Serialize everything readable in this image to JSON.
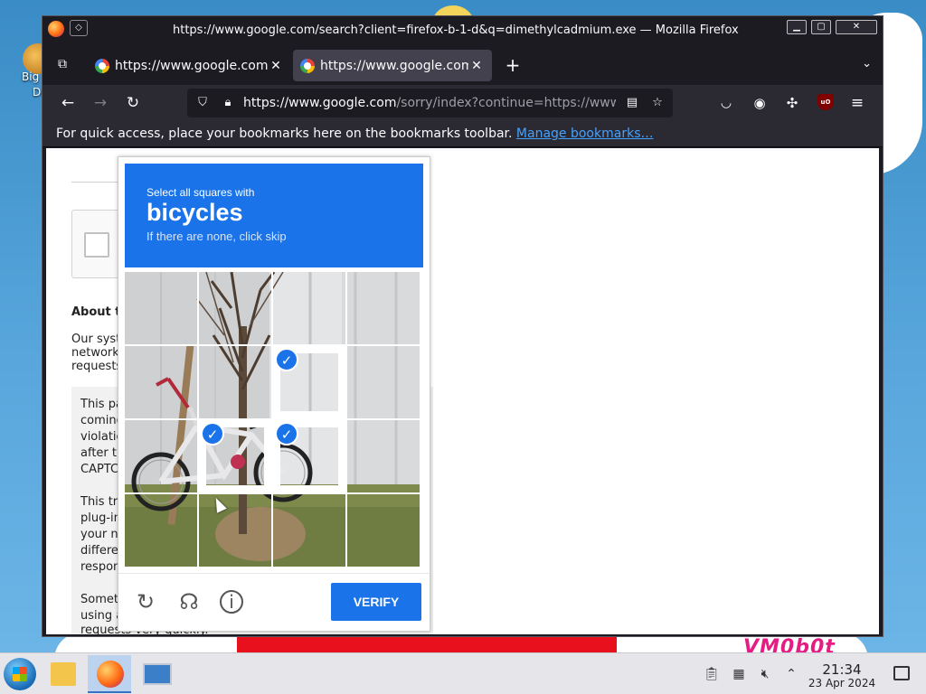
{
  "desktop": {
    "icon_label_line1": "Big",
    "icon_label_line2": "De",
    "watermark": "VM0b0t"
  },
  "window": {
    "title": "https://www.google.com/search?client=firefox-b-1-d&q=dimethylcadmium.exe — Mozilla Firefox",
    "minimize_glyph": "▁",
    "maximize_glyph": "▢",
    "close_glyph": "✕"
  },
  "tabs": [
    {
      "label": "https://www.google.com/search",
      "close": "✕",
      "active": false
    },
    {
      "label": "https://www.google.com/sorry",
      "close": "✕",
      "active": true
    }
  ],
  "tabbar": {
    "new_tab": "+",
    "list_all": "⌄"
  },
  "navbar": {
    "back": "←",
    "forward": "→",
    "reload": "↻",
    "url_host": "https://www.google.com",
    "url_path": "/sorry/index?continue=https://www.google.com/search"
  },
  "bookmarks": {
    "text": "For quick access, place your bookmarks here on the bookmarks toolbar.",
    "link": "Manage bookmarks…"
  },
  "page": {
    "about_heading": "About th",
    "intro_lines": [
      "Our syste",
      "network.",
      "requests"
    ],
    "info_block1": [
      "This pa",
      "coming",
      "violatio",
      "after th",
      "CAPTC"
    ],
    "info_block2": [
      "This tra",
      "plug-in,",
      "your ne",
      "differen",
      "respons"
    ],
    "info_block3": [
      "Someti",
      "using a",
      "requests very quickly."
    ]
  },
  "challenge": {
    "line1": "Select all squares with",
    "target": "bicycles",
    "line3": "If there are none, click skip",
    "selected_tiles": [
      6,
      9,
      10
    ],
    "verify_label": "VERIFY",
    "reload_icon": "reload-icon",
    "audio_icon": "headphones-icon",
    "info_icon": "info-icon",
    "check_glyph": "✓",
    "colors": {
      "header": "#1a73e8",
      "verify": "#1a73e8",
      "check": "#1a73e8"
    }
  },
  "taskbar": {
    "time": "21:34",
    "date": "23 Apr 2024"
  }
}
